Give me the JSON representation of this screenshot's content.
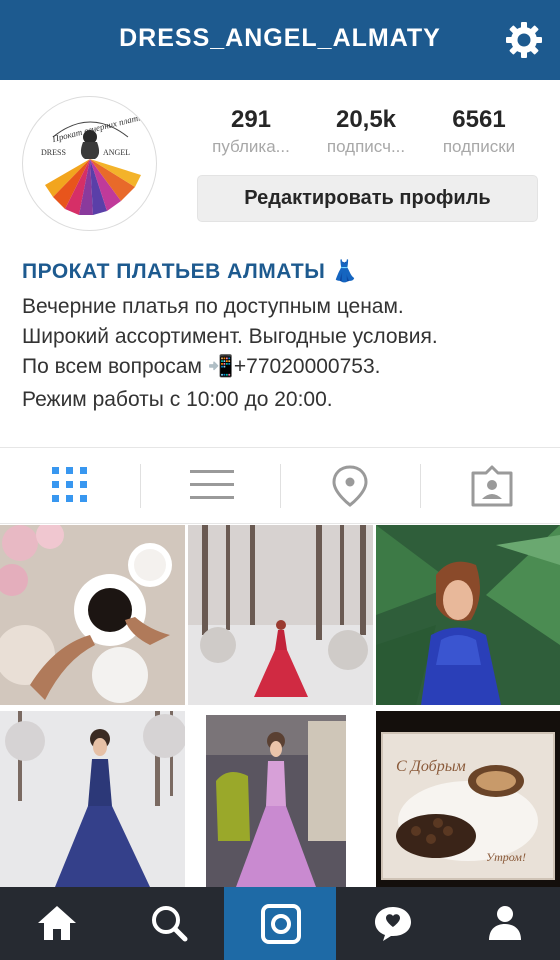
{
  "header": {
    "title": "DRESS_ANGEL_ALMATY",
    "settings_icon": "gear-icon"
  },
  "profile": {
    "avatar_logo_text": "Прокат вечерних платья · DRESS ANGEL",
    "stats": [
      {
        "count": "291",
        "label": "публика..."
      },
      {
        "count": "20,5k",
        "label": "подписч..."
      },
      {
        "count": "6561",
        "label": "подписки"
      }
    ],
    "edit_button_label": "Редактировать профиль"
  },
  "bio": {
    "name": "ПРОКАТ ПЛАТЬЕВ АЛМАТЫ 👗",
    "lines": [
      "Вечерние платья по доступным ценам.",
      "Широкий ассортимент. Выгодные условия.",
      "По всем вопросам 📲+77020000753.",
      "Режим работы с 10:00 до 20:00."
    ]
  },
  "view_tabs": [
    {
      "icon": "grid-icon",
      "active": true
    },
    {
      "icon": "list-icon",
      "active": false
    },
    {
      "icon": "location-pin-icon",
      "active": false
    },
    {
      "icon": "tagged-person-icon",
      "active": false
    }
  ],
  "photos": [
    {
      "subject": "coffee-cups-and-roses"
    },
    {
      "subject": "red-dress-in-snowy-forest"
    },
    {
      "subject": "blue-dress-with-palm-leaves"
    },
    {
      "subject": "navy-sequin-gown-in-snow"
    },
    {
      "subject": "lilac-gown-indoor"
    },
    {
      "subject": "coffee-greeting-card"
    }
  ],
  "bottom_nav": [
    {
      "icon": "home-icon",
      "active": false
    },
    {
      "icon": "search-icon",
      "active": false
    },
    {
      "icon": "camera-icon",
      "active": true
    },
    {
      "icon": "activity-icon",
      "active": false
    },
    {
      "icon": "profile-icon",
      "active": false
    }
  ],
  "colors": {
    "header_bg": "#1d5a8f",
    "nav_bg": "#262a31",
    "nav_active": "#1e6aa6",
    "tab_active": "#3897f0"
  }
}
